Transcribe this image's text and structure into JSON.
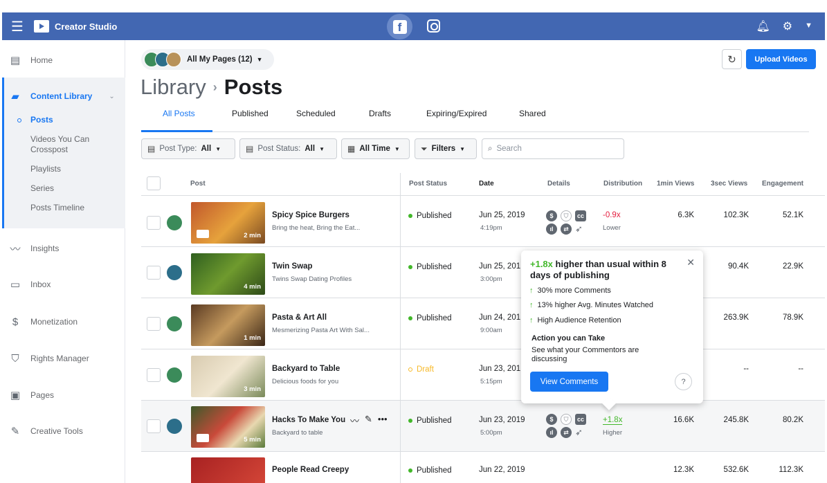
{
  "app": {
    "title": "Creator Studio",
    "colors": {
      "brand": "#4267b2",
      "accent": "#1877f2",
      "success": "#42b72a",
      "draft": "#f7b928",
      "negative": "#e41e3f"
    }
  },
  "sidebar": {
    "items": [
      {
        "label": "Home",
        "icon": "home-icon"
      },
      {
        "label": "Content Library",
        "icon": "content-library-icon",
        "active": true
      },
      {
        "label": "Insights",
        "icon": "insights-icon"
      },
      {
        "label": "Inbox",
        "icon": "inbox-icon"
      },
      {
        "label": "Monetization",
        "icon": "monetization-icon"
      },
      {
        "label": "Rights Manager",
        "icon": "shield-icon"
      },
      {
        "label": "Pages",
        "icon": "pages-icon"
      },
      {
        "label": "Creative Tools",
        "icon": "creative-tools-icon"
      }
    ],
    "sub": [
      "Posts",
      "Videos You Can Crosspost",
      "Playlists",
      "Series",
      "Posts Timeline"
    ]
  },
  "header": {
    "pages_selector": "All My Pages (12)",
    "crumb_parent": "Library",
    "crumb_current": "Posts",
    "upload": "Upload Videos"
  },
  "tabs": [
    "All Posts",
    "Published",
    "Scheduled",
    "Drafts",
    "Expiring/Expired",
    "Shared"
  ],
  "filters": {
    "post_type_label": "Post Type:",
    "post_type_value": "All",
    "post_status_label": "Post Status:",
    "post_status_value": "All",
    "time": "All Time",
    "filters": "Filters",
    "search_placeholder": "Search"
  },
  "columns": [
    "Post",
    "Post Status",
    "Date",
    "Details",
    "Distribution",
    "1min Views",
    "3sec Views",
    "Engagement"
  ],
  "rows": [
    {
      "title": "Spicy Spice Burgers",
      "sub": "Bring the heat, Bring the Eat...",
      "duration": "2 min",
      "status": "Published",
      "date": "Jun 25, 2019",
      "time": "4:19pm",
      "dist": "-0.9x",
      "dist_sub": "Lower",
      "v1": "6.3K",
      "v3": "102.3K",
      "eng": "52.1K"
    },
    {
      "title": "Twin Swap",
      "sub": "Twins Swap Dating Profiles",
      "duration": "4 min",
      "status": "Published",
      "date": "Jun 25, 201",
      "time": "3:00pm",
      "v3": "90.4K",
      "eng": "22.9K"
    },
    {
      "title": "Pasta & Art All",
      "sub": "Mesmerizing Pasta Art With Sal...",
      "duration": "1 min",
      "status": "Published",
      "date": "Jun 24, 201",
      "time": "9:00am",
      "v3": "263.9K",
      "eng": "78.9K"
    },
    {
      "title": "Backyard to Table",
      "sub": "Delicious foods for you",
      "duration": "3 min",
      "status": "Draft",
      "date": "Jun 23, 201",
      "time": "5:15pm",
      "v3": "--",
      "eng": "--"
    },
    {
      "title": "Hacks To Make You",
      "sub": "Backyard to table",
      "duration": "5 min",
      "status": "Published",
      "date": "Jun 23, 2019",
      "time": "5:00pm",
      "dist": "+1.8x",
      "dist_sub": "Higher",
      "v1": "16.6K",
      "v3": "245.8K",
      "eng": "80.2K"
    },
    {
      "title": "People Read Creepy",
      "status": "Published",
      "date": "Jun 22, 2019",
      "v1": "12.3K",
      "v3": "532.6K",
      "eng": "112.3K"
    }
  ],
  "popover": {
    "mult": "+1.8x",
    "head": "higher than usual within 8 days of publishing",
    "items": [
      "30% more Comments",
      "13% higher Avg. Minutes Watched",
      "High Audience Retention"
    ],
    "action_title": "Action you can Take",
    "action_desc": "See what your Commentors are discussing",
    "button": "View Comments"
  }
}
